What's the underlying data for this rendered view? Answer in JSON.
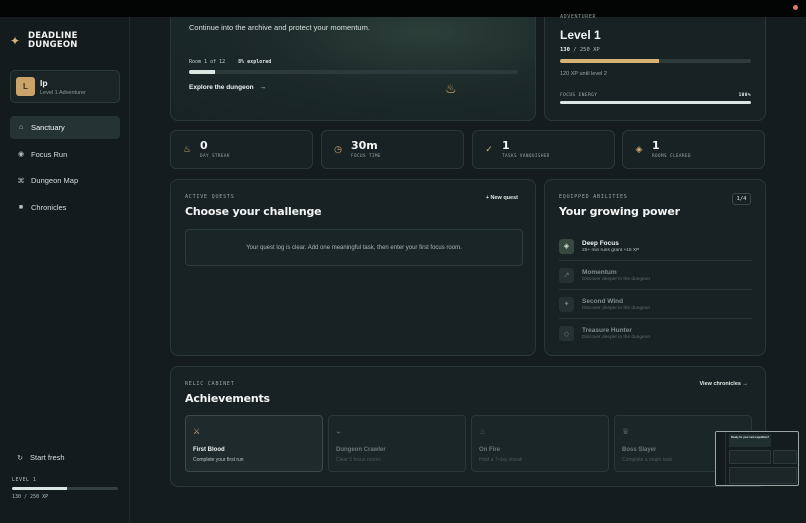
{
  "brand": {
    "line1": "DEADLINE",
    "line2": "DUNGEON"
  },
  "profile": {
    "initial": "L",
    "name": "lp",
    "subtitle": "Level 1 Adventurer"
  },
  "nav": [
    {
      "label": "Sanctuary",
      "icon": "home-icon",
      "active": true
    },
    {
      "label": "Focus Run",
      "icon": "target-icon",
      "active": false
    },
    {
      "label": "Dungeon Map",
      "icon": "map-icon",
      "active": false
    },
    {
      "label": "Chronicles",
      "icon": "book-icon",
      "active": false
    }
  ],
  "sidebar_footer": {
    "start_fresh": "Start fresh",
    "level_label": "LEVEL 1",
    "xp_text": "130 / 250 XP",
    "xp_progress": 0.52
  },
  "hero": {
    "text": "Continue into the archive and protect your momentum.",
    "room_text": "Room 1 of 12",
    "explored_text": "8% explored",
    "explored_progress": 0.08,
    "cta": "Explore the dungeon",
    "cta_arrow": "→"
  },
  "adventurer": {
    "kicker": "ADVENTURER",
    "level": "Level 1",
    "xp_current": "130",
    "xp_rest": " / 250 XP",
    "xp_progress": 0.52,
    "until": "120 XP until level 2",
    "energy_label": "FOCUS ENERGY",
    "energy_value": "100%",
    "energy_progress": 1.0
  },
  "stats": [
    {
      "icon": "flame-icon",
      "value": "0",
      "label": "DAY STREAK"
    },
    {
      "icon": "clock-icon",
      "value": "30m",
      "label": "FOCUS TIME"
    },
    {
      "icon": "check-icon",
      "value": "1",
      "label": "TASKS VANQUISHED"
    },
    {
      "icon": "diamond-icon",
      "value": "1",
      "label": "ROOMS CLEARED"
    }
  ],
  "quests": {
    "kicker": "ACTIVE QUESTS",
    "title": "Choose your challenge",
    "new_quest": "+ New quest",
    "empty": "Your quest log is clear. Add one meaningful task, then enter your first focus room."
  },
  "abilities": {
    "kicker": "EQUIPPED ABILITIES",
    "title": "Your growing power",
    "count": "1/4",
    "items": [
      {
        "name": "Deep Focus",
        "desc": "25+ min runs grant +15 XP",
        "unlocked": true,
        "icon": "gem-icon"
      },
      {
        "name": "Momentum",
        "desc": "Discover deeper in the dungeon",
        "unlocked": false,
        "icon": "arrow-icon"
      },
      {
        "name": "Second Wind",
        "desc": "Discover deeper in the dungeon",
        "unlocked": false,
        "icon": "sparkle-icon"
      },
      {
        "name": "Treasure Hunter",
        "desc": "Discover deeper in the dungeon",
        "unlocked": false,
        "icon": "diamond-icon"
      }
    ]
  },
  "relics": {
    "kicker": "RELIC CABINET",
    "title": "Achievements",
    "view_link": "View chronicles →",
    "items": [
      {
        "name": "First Blood",
        "desc": "Complete your first run",
        "unlocked": true,
        "icon": "swords-icon"
      },
      {
        "name": "Dungeon Crawler",
        "desc": "Clear 5 focus rooms",
        "unlocked": false,
        "icon": "helmet-icon"
      },
      {
        "name": "On Fire",
        "desc": "Hold a 7-day streak",
        "unlocked": false,
        "icon": "flame-icon"
      },
      {
        "name": "Boss Slayer",
        "desc": "Complete a major task",
        "unlocked": false,
        "icon": "crown-icon"
      }
    ]
  },
  "preview": {
    "title": "Ready for your next expedition?"
  },
  "colors": {
    "accent_gold": "#d6b276",
    "accent_mint": "#d9e6e1",
    "background": "#141c1e"
  }
}
